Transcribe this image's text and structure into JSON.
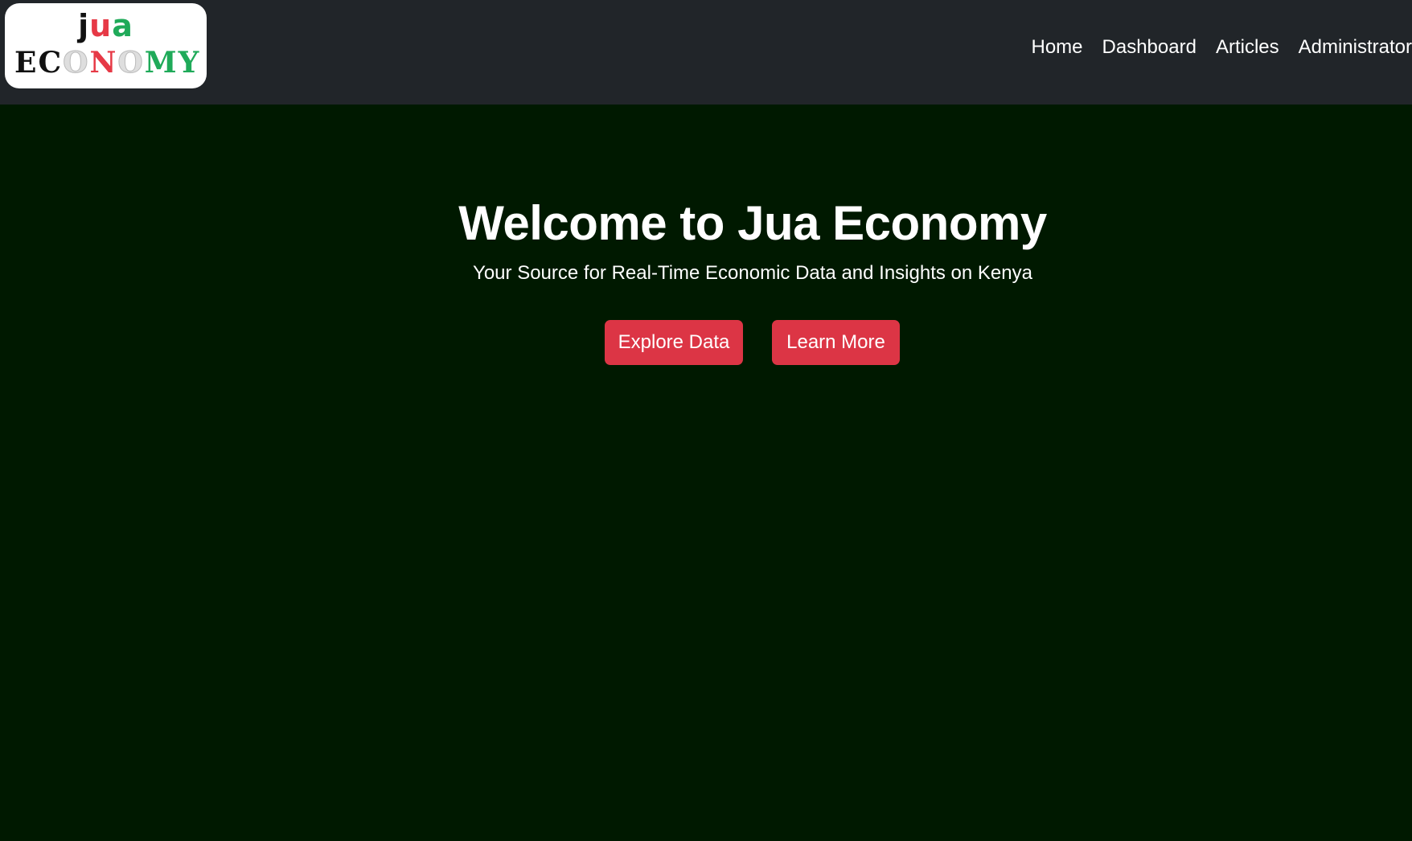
{
  "logo": {
    "letters_top": [
      {
        "char": "j",
        "color": "#111111"
      },
      {
        "char": "u",
        "color": "#e63946"
      },
      {
        "char": "a",
        "color": "#1faa59"
      }
    ],
    "letters_bottom": [
      {
        "char": "E",
        "color": "#111111"
      },
      {
        "char": "C",
        "color": "#111111"
      },
      {
        "char": "O",
        "color": "#dedede"
      },
      {
        "char": "N",
        "color": "#e63946"
      },
      {
        "char": "O",
        "color": "#dedede"
      },
      {
        "char": "M",
        "color": "#1faa59"
      },
      {
        "char": "Y",
        "color": "#1faa59"
      }
    ]
  },
  "nav": {
    "home": "Home",
    "dashboard": "Dashboard",
    "articles": "Articles",
    "administrator": "Administrator"
  },
  "hero": {
    "title": "Welcome to Jua Economy",
    "subtitle": "Your Source for Real-Time Economic Data and Insights on Kenya",
    "explore_label": "Explore Data",
    "learn_label": "Learn More"
  },
  "colors": {
    "navbar_bg": "#212529",
    "hero_bg": "#001900",
    "button_bg": "#dc3545",
    "text": "#ffffff"
  }
}
